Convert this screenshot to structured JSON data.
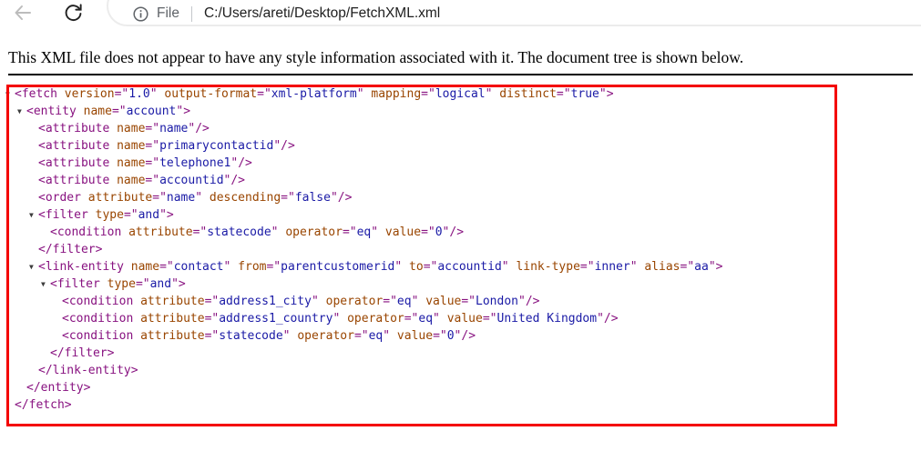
{
  "toolbar": {
    "back_icon": "back-arrow",
    "reload_icon": "reload",
    "info_icon": "page-info",
    "file_label": "File",
    "url": "C:/Users/areti/Desktop/FetchXML.xml"
  },
  "header": {
    "message": "This XML file does not appear to have any style information associated with it. The document tree is shown below."
  },
  "xml_tree": {
    "colors": {
      "tag": "#881280",
      "attr": "#994500",
      "value": "#1a1aa6",
      "arrow": "#3c3c3c"
    },
    "nodes": [
      {
        "indent": 0,
        "arrow": true,
        "kind": "open",
        "tag": "fetch",
        "attrs": [
          [
            "version",
            "1.0"
          ],
          [
            "output-format",
            "xml-platform"
          ],
          [
            "mapping",
            "logical"
          ],
          [
            "distinct",
            "true"
          ]
        ]
      },
      {
        "indent": 1,
        "arrow": true,
        "kind": "open",
        "tag": "entity",
        "attrs": [
          [
            "name",
            "account"
          ]
        ]
      },
      {
        "indent": 2,
        "arrow": false,
        "kind": "self",
        "tag": "attribute",
        "attrs": [
          [
            "name",
            "name"
          ]
        ]
      },
      {
        "indent": 2,
        "arrow": false,
        "kind": "self",
        "tag": "attribute",
        "attrs": [
          [
            "name",
            "primarycontactid"
          ]
        ]
      },
      {
        "indent": 2,
        "arrow": false,
        "kind": "self",
        "tag": "attribute",
        "attrs": [
          [
            "name",
            "telephone1"
          ]
        ]
      },
      {
        "indent": 2,
        "arrow": false,
        "kind": "self",
        "tag": "attribute",
        "attrs": [
          [
            "name",
            "accountid"
          ]
        ]
      },
      {
        "indent": 2,
        "arrow": false,
        "kind": "self",
        "tag": "order",
        "attrs": [
          [
            "attribute",
            "name"
          ],
          [
            "descending",
            "false"
          ]
        ]
      },
      {
        "indent": 2,
        "arrow": true,
        "kind": "open",
        "tag": "filter",
        "attrs": [
          [
            "type",
            "and"
          ]
        ]
      },
      {
        "indent": 3,
        "arrow": false,
        "kind": "self",
        "tag": "condition",
        "attrs": [
          [
            "attribute",
            "statecode"
          ],
          [
            "operator",
            "eq"
          ],
          [
            "value",
            "0"
          ]
        ]
      },
      {
        "indent": 2,
        "arrow": false,
        "kind": "close",
        "tag": "filter"
      },
      {
        "indent": 2,
        "arrow": true,
        "kind": "open",
        "tag": "link-entity",
        "attrs": [
          [
            "name",
            "contact"
          ],
          [
            "from",
            "parentcustomerid"
          ],
          [
            "to",
            "accountid"
          ],
          [
            "link-type",
            "inner"
          ],
          [
            "alias",
            "aa"
          ]
        ]
      },
      {
        "indent": 3,
        "arrow": true,
        "kind": "open",
        "tag": "filter",
        "attrs": [
          [
            "type",
            "and"
          ]
        ]
      },
      {
        "indent": 4,
        "arrow": false,
        "kind": "self",
        "tag": "condition",
        "attrs": [
          [
            "attribute",
            "address1_city"
          ],
          [
            "operator",
            "eq"
          ],
          [
            "value",
            "London"
          ]
        ]
      },
      {
        "indent": 4,
        "arrow": false,
        "kind": "self",
        "tag": "condition",
        "attrs": [
          [
            "attribute",
            "address1_country"
          ],
          [
            "operator",
            "eq"
          ],
          [
            "value",
            "United Kingdom"
          ]
        ]
      },
      {
        "indent": 4,
        "arrow": false,
        "kind": "self",
        "tag": "condition",
        "attrs": [
          [
            "attribute",
            "statecode"
          ],
          [
            "operator",
            "eq"
          ],
          [
            "value",
            "0"
          ]
        ]
      },
      {
        "indent": 3,
        "arrow": false,
        "kind": "close",
        "tag": "filter"
      },
      {
        "indent": 2,
        "arrow": false,
        "kind": "close",
        "tag": "link-entity"
      },
      {
        "indent": 1,
        "arrow": false,
        "kind": "close",
        "tag": "entity"
      },
      {
        "indent": 0,
        "arrow": false,
        "kind": "close",
        "tag": "fetch"
      }
    ]
  },
  "annotation": {
    "color": "#f40000"
  }
}
